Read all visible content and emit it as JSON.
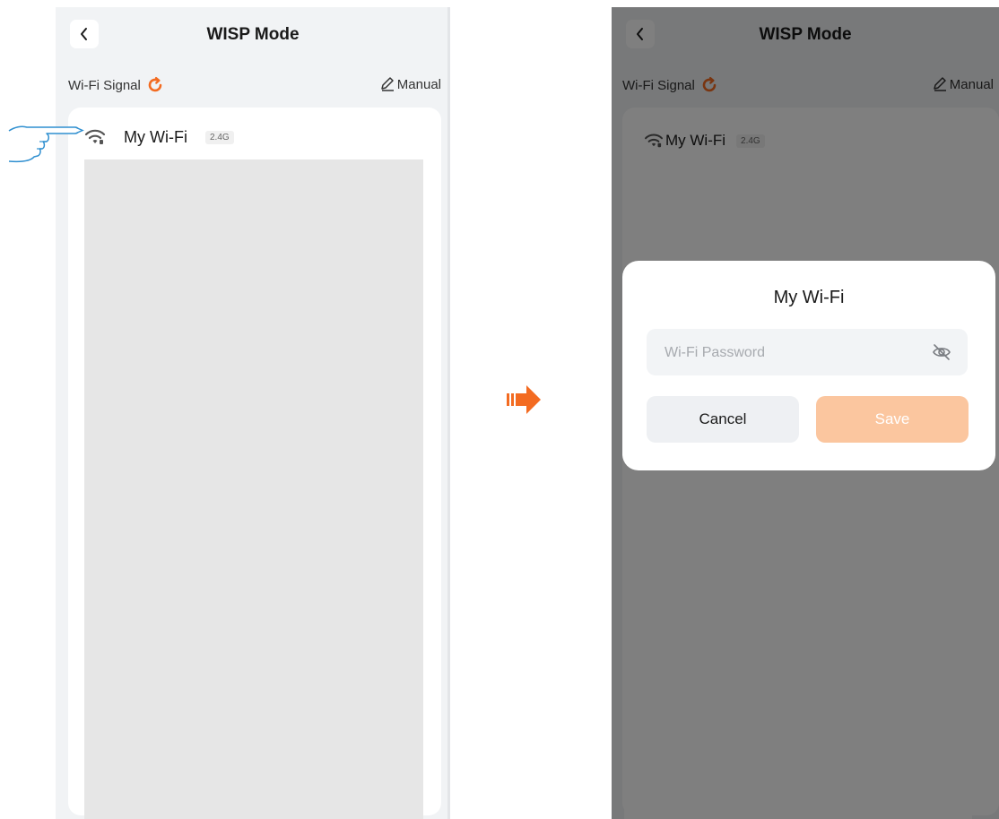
{
  "colors": {
    "accent_orange": "#f36b21",
    "save_disabled": "#fbc69f",
    "overlay": "rgba(0,0,0,0.5)",
    "page_bg": "#f1f3f5"
  },
  "left_screen": {
    "header": {
      "title": "WISP Mode",
      "back_icon": "chevron-left-icon"
    },
    "section": {
      "label": "Wi-Fi Signal",
      "refresh_icon": "refresh-icon",
      "manual_label": "Manual",
      "manual_icon": "pencil-icon"
    },
    "networks": [
      {
        "ssid": "My Wi-Fi",
        "band": "2.4G",
        "icon": "wifi-icon"
      }
    ]
  },
  "transition": {
    "icon": "arrow-right-icon"
  },
  "right_screen": {
    "header": {
      "title": "WISP Mode",
      "back_icon": "chevron-left-icon"
    },
    "section": {
      "label": "Wi-Fi Signal",
      "refresh_icon": "refresh-icon",
      "manual_label": "Manual",
      "manual_icon": "pencil-icon"
    },
    "networks": [
      {
        "ssid": "My Wi-Fi",
        "band": "2.4G",
        "icon": "wifi-icon"
      }
    ],
    "dialog": {
      "title": "My Wi-Fi",
      "password_value": "",
      "password_placeholder": "Wi-Fi Password",
      "visibility_icon": "eye-off-icon",
      "cancel_label": "Cancel",
      "save_label": "Save"
    }
  }
}
